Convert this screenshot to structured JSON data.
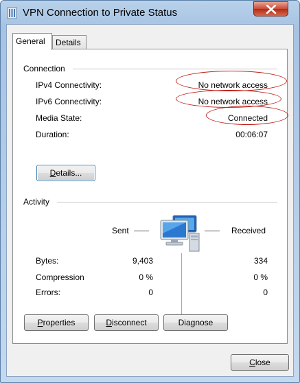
{
  "window": {
    "title": "VPN Connection to Private Status",
    "close_glyph": "X"
  },
  "tabs": [
    {
      "label": "General",
      "active": true
    },
    {
      "label": "Details",
      "active": false
    }
  ],
  "connection": {
    "section_label": "Connection",
    "rows": [
      {
        "label": "IPv4 Connectivity:",
        "value": "No network access",
        "highlighted": true
      },
      {
        "label": "IPv6 Connectivity:",
        "value": "No network access",
        "highlighted": true
      },
      {
        "label": "Media State:",
        "value": "Connected",
        "highlighted": true
      },
      {
        "label": "Duration:",
        "value": "00:06:07",
        "highlighted": false
      }
    ],
    "details_button": {
      "label_mnemonic": "D",
      "label_rest": "etails..."
    }
  },
  "activity": {
    "section_label": "Activity",
    "sent_label": "Sent",
    "received_label": "Received",
    "icon": "network-computers-icon",
    "rows": [
      {
        "label": "Bytes:",
        "sent": "9,403",
        "received": "334"
      },
      {
        "label": "Compression",
        "sent": "0 %",
        "received": "0 %"
      },
      {
        "label": "Errors:",
        "sent": "0",
        "received": "0"
      }
    ]
  },
  "buttons": {
    "properties": {
      "mnemonic": "P",
      "rest": "roperties"
    },
    "disconnect": {
      "mnemonic": "D",
      "rest": "isconnect"
    },
    "diagnose": {
      "prefix": "Dia",
      "mnemonic": "g",
      "rest": "nose"
    },
    "close": {
      "mnemonic": "C",
      "rest": "lose"
    }
  },
  "colors": {
    "highlight_oval": "#c0201a",
    "title_bar": "#b9d1ea",
    "close_button": "#c94a34"
  }
}
